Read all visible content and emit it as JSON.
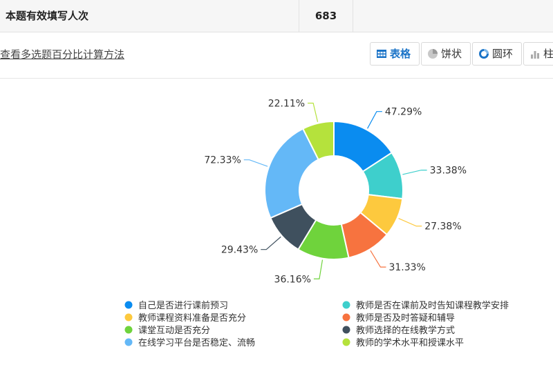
{
  "summary": {
    "label": "本题有效填写人次",
    "value": "683"
  },
  "method_link": "查看多选题百分比计算方法",
  "view_toggle": [
    {
      "label": "表格",
      "icon": "table-icon",
      "active": true
    },
    {
      "label": "饼状",
      "icon": "pie-icon",
      "active": false
    },
    {
      "label": "圆环",
      "icon": "donut-icon",
      "active": false
    },
    {
      "label": "柱",
      "icon": "bar-icon",
      "active": false
    }
  ],
  "colors": {
    "accent": "#1a73c7"
  },
  "chart_data": {
    "type": "pie",
    "variant": "donut",
    "legend_position": "bottom",
    "categories": [
      "自己是否进行课前预习",
      "教师是否在课前及时告知课程教学安排",
      "教师课程资料准备是否充分",
      "教师是否及时答疑和辅导",
      "课堂互动是否充分",
      "教师选择的在线教学方式",
      "在线学习平台是否稳定、流畅",
      "教师的学术水平和授课水平"
    ],
    "values": [
      47.29,
      33.38,
      27.38,
      31.33,
      36.16,
      29.43,
      72.33,
      22.11
    ],
    "value_labels": [
      "47.29%",
      "33.38%",
      "27.38%",
      "31.33%",
      "36.16%",
      "29.43%",
      "72.33%",
      "22.11%"
    ],
    "colors": [
      "#0a8cf0",
      "#3ecfcc",
      "#fdc93e",
      "#f7733f",
      "#6fd33c",
      "#3f505e",
      "#64b8f7",
      "#b5e23c"
    ]
  }
}
